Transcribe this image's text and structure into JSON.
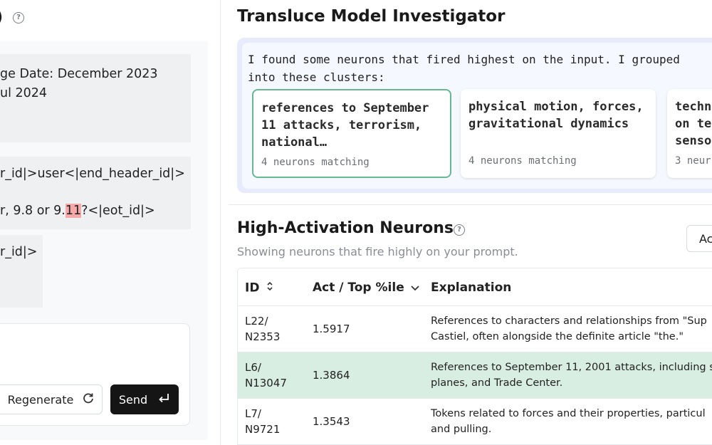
{
  "left": {
    "title_fragment": ")",
    "system_message": {
      "line1": "ge Date: December 2023",
      "line2": "ul 2024"
    },
    "user_message": {
      "line1": "r_id|>user<|end_header_id|>",
      "line2_pre": "r, 9.8 or 9.",
      "line2_highlight": "11",
      "line2_post": "?<|eot_id|>"
    },
    "assistant_message": {
      "line1": "r_id|>"
    },
    "buttons": {
      "regenerate": "Regenerate",
      "send": "Send"
    }
  },
  "right": {
    "title": "Transluce Model Investigator",
    "investigator": {
      "line1": "I found some neurons that fired highest on the input. I grouped",
      "line2": "into these clusters:",
      "clusters": [
        {
          "title": "references to September 11 attacks, terrorism, national…",
          "count": "4 neurons matching"
        },
        {
          "title": "physical motion, forces, gravitational dynamics",
          "count": "4 neurons matching"
        },
        {
          "title": "techn on te senso",
          "count": "3 neur"
        }
      ]
    },
    "neurons": {
      "title": "High-Activation Neurons",
      "subtitle": "Showing neurons that fire highly on your prompt.",
      "button_fragment": "Ac",
      "columns": [
        "ID",
        "Act / Top %ile",
        "Explanation"
      ],
      "rows": [
        {
          "id_layer": "L22/",
          "id_neuron": "N2353",
          "act": "1.5917",
          "exp1": "References to characters and relationships from \"Sup",
          "exp2": "Castiel, often alongside the definite article \"the.\""
        },
        {
          "id_layer": "L6/",
          "id_neuron": "N13047",
          "act": "1.3864",
          "exp1": "References to September 11, 2001 attacks, including s",
          "exp2": "planes, and Trade Center."
        },
        {
          "id_layer": "L7/",
          "id_neuron": "N9721",
          "act": "1.3543",
          "exp1": "Tokens related to forces and their properties, particul",
          "exp2": "and pulling."
        }
      ]
    }
  },
  "colors": {
    "accent_green": "#66b891",
    "selected_row": "#d9eee3",
    "highlight_token": "#f6a9a9",
    "send_button": "#151515"
  }
}
